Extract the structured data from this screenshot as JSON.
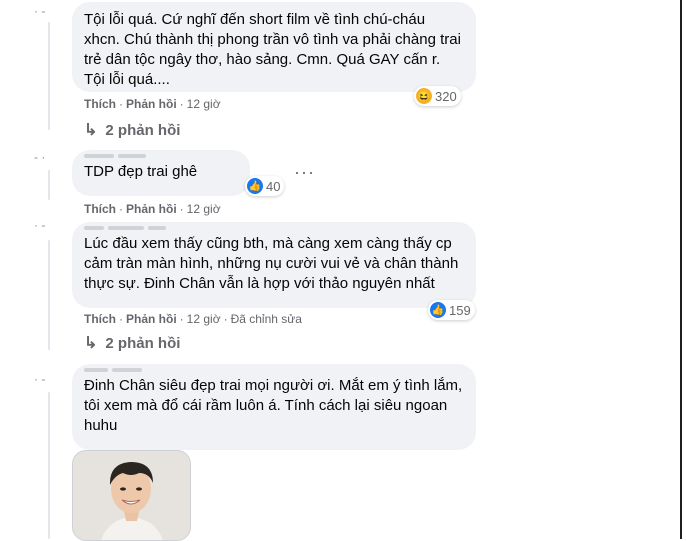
{
  "comments": [
    {
      "text": "Tội lỗi quá. Cứ nghĩ đến short film về tình chú-cháu xhcn. Chú thành thị phong trần vô tình va phải chàng trai trẻ dân tộc ngây thơ, hào sảng. Cmn. Quá GAY cấn r. Tội lỗi quá....",
      "reaction_icon": "haha-icon",
      "reaction_count": "320",
      "like": "Thích",
      "reply": "Phản hồi",
      "time": "12 giờ",
      "replies_label": "2 phản hồi"
    },
    {
      "text": "TDP đẹp trai ghê",
      "reaction_icon": "like-icon",
      "reaction_count": "40",
      "like": "Thích",
      "reply": "Phản hồi",
      "time": "12 giờ"
    },
    {
      "text": "Lúc đầu xem thấy cũng bth, mà càng xem càng thấy cp cảm tràn màn hình, những nụ cười vui vẻ và chân thành thực sự. Đinh Chân vẫn là hợp với thảo nguyên nhất",
      "reaction_icon": "like-icon",
      "reaction_count": "159",
      "like": "Thích",
      "reply": "Phản hồi",
      "time": "12 giờ",
      "edited": "Đã chỉnh sửa",
      "replies_label": "2 phản hồi"
    },
    {
      "text": "Đinh Chân siêu đẹp trai mọi người ơi. Mắt em ý tình lắm, tôi xem mà đổ cái rầm luôn á. Tính cách lại siêu ngoan huhu"
    }
  ],
  "more_options_icon": "more-options-icon",
  "reply_arrow_icon": "reply-arrow-icon"
}
